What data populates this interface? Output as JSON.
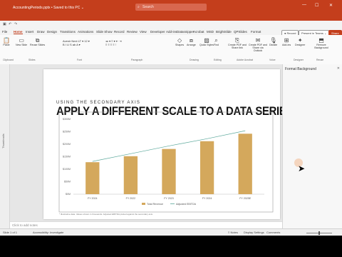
{
  "titlebar": {
    "file_name": "AccountingPeriods.pptx • Saved to this PC ⌄",
    "search_placeholder": "Search",
    "min": "—",
    "max": "☐",
    "close": "✕"
  },
  "tabs": [
    {
      "label": "File"
    },
    {
      "label": "Home"
    },
    {
      "label": "Insert"
    },
    {
      "label": "Draw"
    },
    {
      "label": "Design"
    },
    {
      "label": "Transitions"
    },
    {
      "label": "Animations"
    },
    {
      "label": "Slide Show"
    },
    {
      "label": "Record"
    },
    {
      "label": "Review"
    },
    {
      "label": "View"
    },
    {
      "label": "Developer"
    },
    {
      "label": "Add-ins"
    },
    {
      "label": "Datasnipper"
    },
    {
      "label": "Acrobat"
    },
    {
      "label": "MSD"
    },
    {
      "label": "BrightSlide"
    },
    {
      "label": "QPSlides"
    },
    {
      "label": "Format"
    }
  ],
  "tab_buttons": {
    "record": "● Record",
    "present": "Present in Teams ⌄",
    "share": "Share"
  },
  "ribbon": {
    "paste": "Paste",
    "new_slide": "New Slide",
    "reuse": "Reuse Slides",
    "shapes": "Shapes",
    "arrange": "Arrange",
    "quick_styles": "Quick Styles",
    "find": "Find",
    "add_ins": "Add-ins",
    "designer": "Designer",
    "acrobat1": "Create PDF and Share link",
    "acrobat2": "Create PDF and Share via Outlook",
    "dictate": "Dictate",
    "reuse2": "Reuse Slides",
    "background": "Remove Background"
  },
  "groups": {
    "clipboard": "Clipboard",
    "slides": "Slides",
    "font": "Font",
    "paragraph": "Paragraph",
    "drawing": "Drawing",
    "editing": "Editing",
    "adobe": "Adobe Acrobat",
    "voice": "Voice",
    "designer": "Designer",
    "reuse": "Reuse"
  },
  "slide": {
    "title": "APPLY A DIFFERENT SCALE TO A DATA SERIES",
    "subtitle": "USING THE SECONDARY AXIS",
    "footnote": "* Illustrative data. Values shown in thousands. Adjusted EBITDA plotted against the secondary axis."
  },
  "right_pane": {
    "title": "Format Background",
    "close": "✕"
  },
  "notes": {
    "placeholder": "Click to add notes"
  },
  "status": {
    "slide": "Slide 1 of 1",
    "accessibility": "Accessibility: Investigate",
    "notes": "≡ Notes",
    "display": "Display Settings",
    "comments": "Comments"
  },
  "left_pane": {
    "label": "Thumbnails"
  },
  "float_icons": {
    "elements": "+",
    "styles": "✎",
    "filters": "⧩"
  },
  "chart_data": {
    "type": "bar",
    "categories": [
      "FY 2024",
      "FY 2022",
      "FY 2023",
      "FY 2024",
      "FY 2025E"
    ],
    "series": [
      {
        "name": "Total Revenue",
        "values": [
          128,
          152,
          181,
          212,
          242
        ],
        "color": "#d4a85c",
        "kind": "bar"
      },
      {
        "name": "Adjusted EBITDA",
        "values": [
          131,
          162,
          193,
          222,
          254
        ],
        "color": "#5ba89b",
        "kind": "line"
      }
    ],
    "y_ticks": [
      "$0M",
      "$50M",
      "$100M",
      "$150M",
      "$200M",
      "$250M",
      "$300M"
    ],
    "ylim": [
      0,
      300
    ],
    "legend": "bottom",
    "grid": false
  }
}
